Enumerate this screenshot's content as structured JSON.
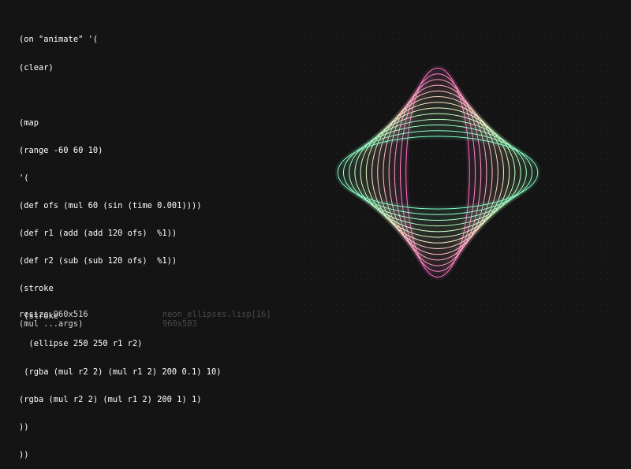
{
  "editor": {
    "lines": [
      "(on \"animate\" '(",
      "(clear)",
      "",
      "(map",
      "(range -60 60 10)",
      "'(",
      "(def ofs (mul 60 (sin (time 0.001))))",
      "(def r1 (add (add 120 ofs)  %1))",
      "(def r2 (sub (sub 120 ofs)  %1))",
      "(stroke",
      " (stroke",
      "  (ellipse 250 250 r1 r2)",
      " (rgba (mul r2 2) (mul r1 2) 200 0.1) 10)",
      "(rgba (mul r2 2) (mul r1 2) 200 1) 1)",
      "))",
      "))"
    ]
  },
  "status": {
    "left": [
      "resize 960x516",
      "(mul ...args)"
    ],
    "right": [
      "neon_ellipses.lisp[16]",
      "960x503"
    ]
  },
  "canvas": {
    "background": "#141414",
    "dot_color": "#2a2a2a",
    "offset_range": {
      "start": -60,
      "end": 60,
      "step": 10
    },
    "ofs": -4,
    "base_radius": 120
  }
}
